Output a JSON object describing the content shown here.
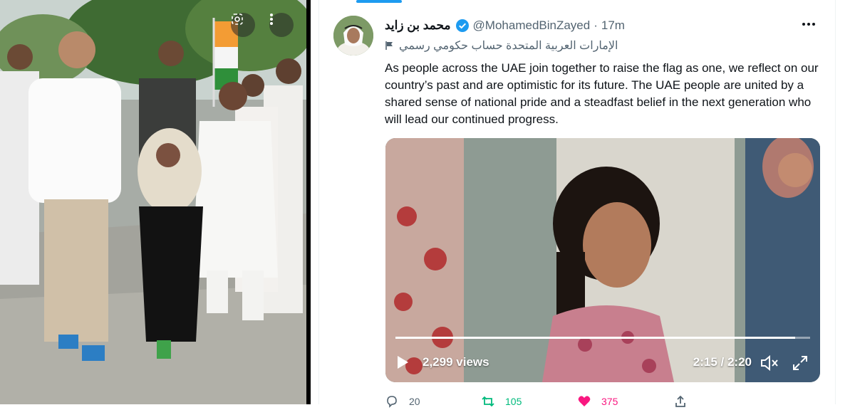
{
  "photo": {
    "alt_icons": [
      "lens-search-icon",
      "more-vertical-icon"
    ]
  },
  "tweet": {
    "author_name": "محمد بن زايد",
    "handle": "@MohamedBinZayed",
    "separator": "·",
    "time": "17m",
    "government_label": "الإمارات العربية المتحدة حساب حكومي رسمي",
    "text": "As people across the UAE join together to raise the flag as one, we reflect on our country’s past and are optimistic for its future. The UAE people are united by a shared sense of national pride and a steadfast belief in the next generation who will lead our continued progress.",
    "video": {
      "views": "2,299 views",
      "timecode": "2:15 / 2:20",
      "progress_fraction": 0.964
    },
    "actions": {
      "replies": "20",
      "retweets": "105",
      "likes": "375"
    }
  },
  "colors": {
    "accent": "#1d9bf0",
    "retweet": "#00ba7c",
    "like": "#f91880",
    "secondary_text": "#536471"
  }
}
